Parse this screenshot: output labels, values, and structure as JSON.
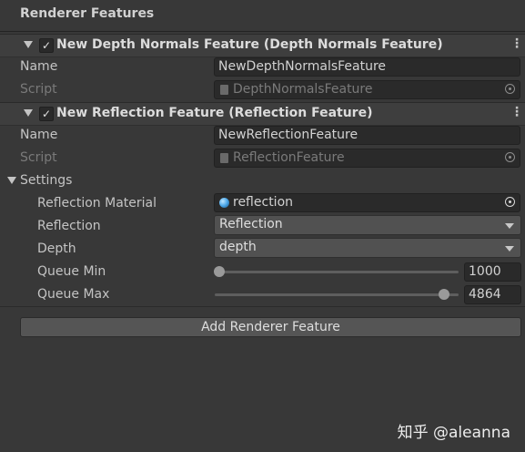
{
  "section": {
    "title": "Renderer Features"
  },
  "features": [
    {
      "header_label": "New Depth Normals Feature (Depth Normals Feature)",
      "checked": true,
      "name_label": "Name",
      "name_value": "NewDepthNormalsFeature",
      "script_label": "Script",
      "script_value": "DepthNormalsFeature"
    },
    {
      "header_label": "New Reflection Feature (Reflection Feature)",
      "checked": true,
      "name_label": "Name",
      "name_value": "NewReflectionFeature",
      "script_label": "Script",
      "script_value": "ReflectionFeature"
    }
  ],
  "settings": {
    "label": "Settings",
    "reflection_material_label": "Reflection Material",
    "reflection_material_value": "reflection",
    "reflection_label": "Reflection",
    "reflection_value": "Reflection",
    "depth_label": "Depth",
    "depth_value": "depth",
    "queue_min_label": "Queue Min",
    "queue_min_value": "1000",
    "queue_min_fraction": 0.0,
    "queue_max_label": "Queue Max",
    "queue_max_value": "4864",
    "queue_max_fraction": 0.94
  },
  "add_button_label": "Add Renderer Feature",
  "watermark": "知乎 @aleanna",
  "icons": {
    "fold": "triangle-down-icon",
    "checkbox": "checkmark-icon",
    "menu": "kebab-menu-icon",
    "script": "script-file-icon",
    "object_picker": "object-picker-icon",
    "material": "material-sphere-icon",
    "dropdown": "dropdown-arrow-icon"
  },
  "check_glyph": "✓",
  "kebab_glyph": "⋮"
}
